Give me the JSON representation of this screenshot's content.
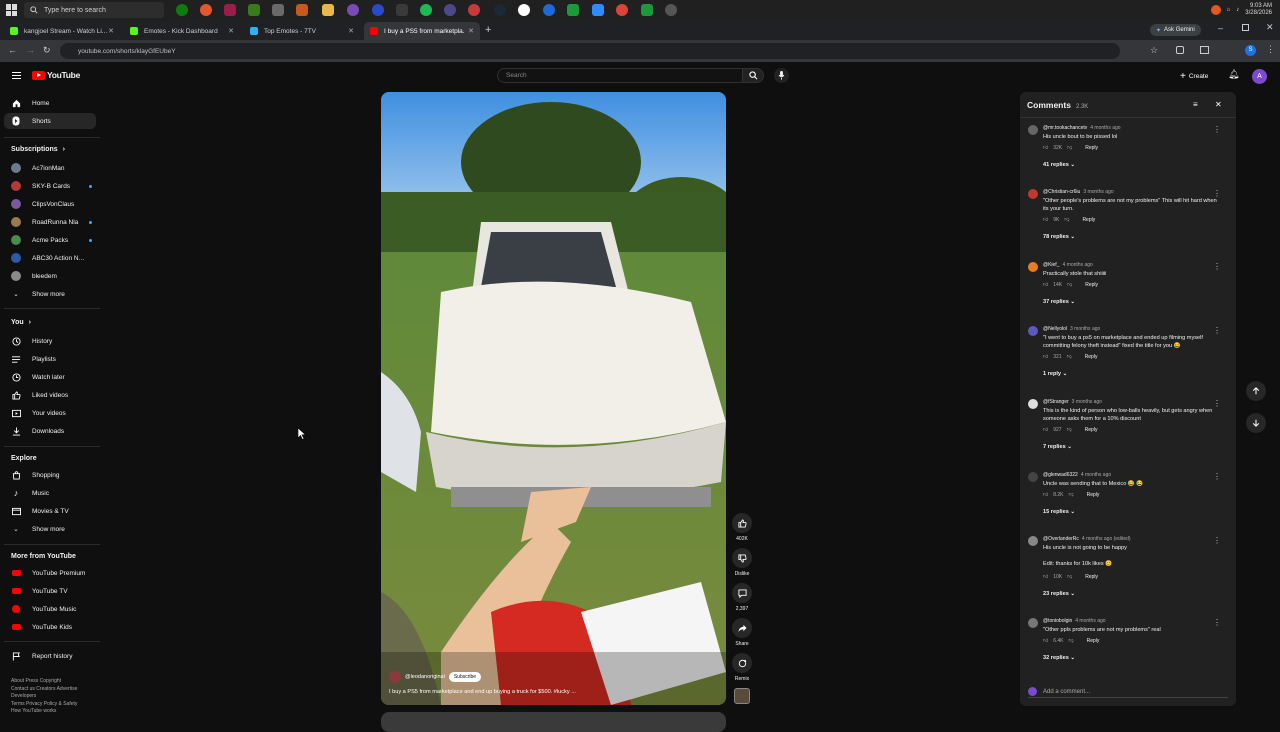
{
  "taskbar": {
    "search_placeholder": "Type here to search",
    "time": "9:03 AM",
    "date": "3/28/2026"
  },
  "tabs": [
    {
      "title": "kangjoel Stream - Watch Li...",
      "color": "#53fc18"
    },
    {
      "title": "Emotes - Kick Dashboard",
      "color": "#53fc18"
    },
    {
      "title": "Top Emotes - 7TV",
      "color": "#29b6f6"
    },
    {
      "title": "I buy a PS5 from marketpla...",
      "color": "#ff0000"
    }
  ],
  "browser": {
    "url": "youtube.com/shorts/klayGfEUbeY",
    "ask_gemini": "Ask Gemini"
  },
  "youtube": {
    "logo_text": "YouTube",
    "search_placeholder": "Search",
    "create_label": "Create",
    "avatar_letter": "A"
  },
  "sidebar": {
    "main": [
      {
        "label": "Home",
        "icon": "home-icon"
      },
      {
        "label": "Shorts",
        "icon": "shorts-icon"
      }
    ],
    "subscriptions_title": "Subscriptions",
    "subscriptions": [
      {
        "label": "Ac7ionMan",
        "color": "#6b7b8c",
        "dot": false
      },
      {
        "label": "SKY-B Cards",
        "color": "#b23a3a",
        "dot": true
      },
      {
        "label": "ClipsVonClaus",
        "color": "#7a5a9a",
        "dot": false
      },
      {
        "label": "RoadRunna Nla",
        "color": "#9a7a4a",
        "dot": true
      },
      {
        "label": "Acme Packs",
        "color": "#4a8a4a",
        "dot": true
      },
      {
        "label": "ABC30 Action N...",
        "color": "#2a5aa8",
        "dot": false
      },
      {
        "label": "bleedem",
        "color": "#8a8a8a",
        "dot": false
      }
    ],
    "show_more": "Show more",
    "you_title": "You",
    "you": [
      {
        "label": "History",
        "icon": "history-icon"
      },
      {
        "label": "Playlists",
        "icon": "playlists-icon"
      },
      {
        "label": "Watch later",
        "icon": "watch-later-icon"
      },
      {
        "label": "Liked videos",
        "icon": "like-icon"
      },
      {
        "label": "Your videos",
        "icon": "your-videos-icon"
      },
      {
        "label": "Downloads",
        "icon": "download-icon"
      }
    ],
    "explore_title": "Explore",
    "explore": [
      {
        "label": "Shopping",
        "icon": "shopping-icon"
      },
      {
        "label": "Music",
        "icon": "music-icon"
      },
      {
        "label": "Movies & TV",
        "icon": "movies-icon"
      }
    ],
    "show_more_2": "Show more",
    "more_title": "More from YouTube",
    "more": [
      {
        "label": "YouTube Premium"
      },
      {
        "label": "YouTube TV"
      },
      {
        "label": "YouTube Music"
      },
      {
        "label": "YouTube Kids"
      }
    ],
    "report_history": "Report history",
    "footer": "About  Press  Copyright\nContact us  Creators  Advertise\nDevelopers\nTerms  Privacy  Policy & Safety\nHow YouTube works"
  },
  "video": {
    "channel": "@leodanoriginal",
    "subscribe": "Subscribe",
    "caption": "I buy a PS5 from marketplace and end up buying a truck for $500. #lucky ..."
  },
  "actions": {
    "likes": "402K",
    "dislike": "Dislike",
    "comments": "2,397",
    "share": "Share",
    "remix": "Remix"
  },
  "comments_panel": {
    "title": "Comments",
    "count": "2.3K",
    "add_placeholder": "Add a comment...",
    "reply_label": "Reply",
    "items": [
      {
        "user": "@mr.tookachancetv",
        "time": "4 months ago",
        "text": "His uncle bout to be pissed lol",
        "likes": "32K",
        "replies": "41 replies",
        "color": "#666666"
      },
      {
        "user": "@Christian-cr6iu",
        "time": "3 months ago",
        "text": "\"Other people's problems are not my problems\" This will hit hard when its your turn.",
        "likes": "9K",
        "replies": "78 replies",
        "color": "#c0392b"
      },
      {
        "user": "@Kief_",
        "time": "4 months ago",
        "text": "Practically stole that shiiiii",
        "likes": "14K",
        "replies": "37 replies",
        "color": "#e67e22"
      },
      {
        "user": "@Nellyolol",
        "time": "3 months ago",
        "text": "\"I went to buy a ps5 on marketplace and ended up filming myself committing felony theft instead\" fixed the title for you 😂",
        "likes": "321",
        "replies": "1 reply",
        "color": "#5a5ac0"
      },
      {
        "user": "@fStranger",
        "time": "3 months ago",
        "text": "This is the kind of person who low-balls heavily, but gets angry when someone asks them for a 10% discount",
        "likes": "927",
        "replies": "7 replies",
        "color": "#dddddd"
      },
      {
        "user": "@glenwad6322",
        "time": "4 months ago",
        "text": "Uncle was sending that to Mexico 😂 😂",
        "likes": "8.2K",
        "replies": "15 replies",
        "color": "#444444"
      },
      {
        "user": "@OverlanderRc",
        "time": "4 months ago (edited)",
        "text": "His uncle is not going to be happy\n\nEdit: thanks for 10k likes 😊",
        "likes": "10K",
        "replies": "23 replies",
        "color": "#888888"
      },
      {
        "user": "@toniobolgin",
        "time": "4 months ago",
        "text": "\"Other ppls problems are not my problems\" real",
        "likes": "6.4K",
        "replies": "32 replies",
        "color": "#777777"
      }
    ]
  }
}
